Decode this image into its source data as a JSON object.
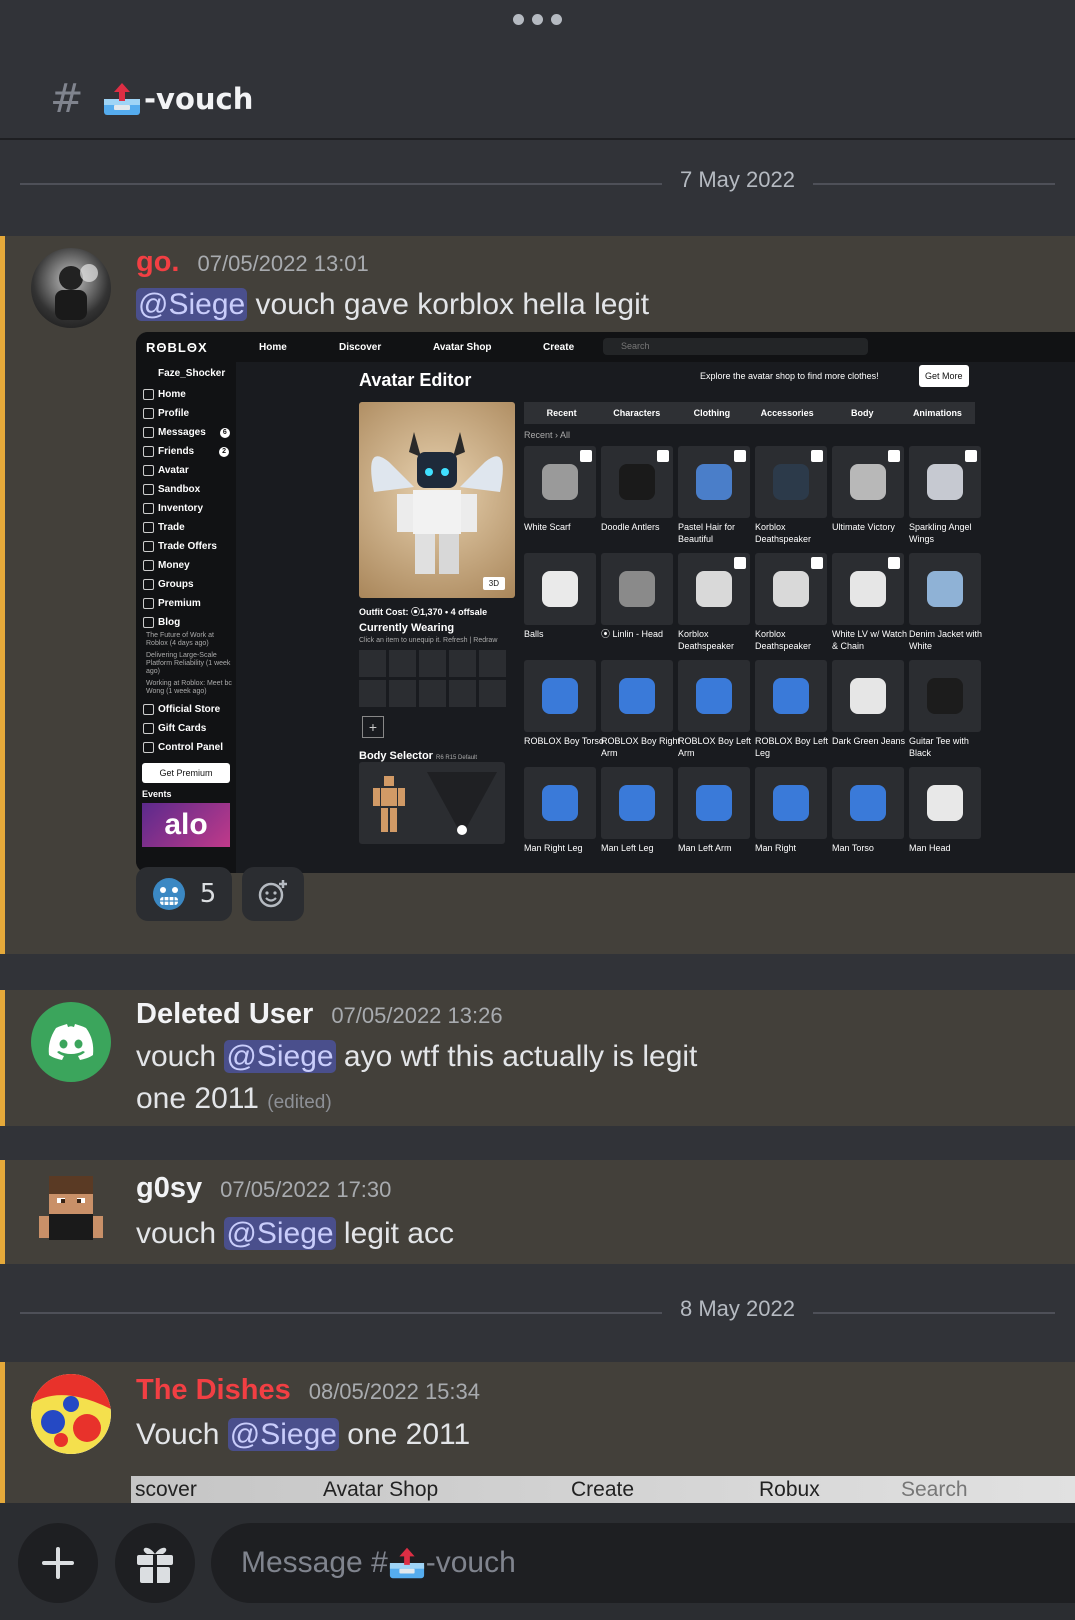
{
  "channel": {
    "hash": "#",
    "name": "-vouch",
    "emoji_icon": "inbox-tray-icon"
  },
  "dates": [
    "7 May 2022",
    "8 May 2022"
  ],
  "messages": [
    {
      "author": "go.",
      "author_color": "#f23f43",
      "timestamp": "07/05/2022 13:01",
      "mention": "@Siege",
      "text_after": " vouch gave korblox hella legit",
      "embed": {
        "top_nav": [
          "Home",
          "Discover",
          "Avatar Shop",
          "Create"
        ],
        "search_placeholder": "Search",
        "logo": "RΘBLΘX",
        "username": "Faze_Shocker",
        "sidebar": [
          "Home",
          "Profile",
          "Messages",
          "Friends",
          "Avatar",
          "Sandbox",
          "Inventory",
          "Trade",
          "Trade Offers",
          "Money",
          "Groups",
          "Premium",
          "Blog"
        ],
        "sidebar_badges": {
          "messages": "6",
          "friends": "2"
        },
        "blog_posts": [
          "The Future of Work at Roblox (4 days ago)",
          "Delivering Large-Scale Platform Reliability (1 week ago)",
          "Working at Roblox: Meet bc Wong (1 week ago)"
        ],
        "sidebar_bottom": [
          "Official Store",
          "Gift Cards",
          "Control Panel"
        ],
        "get_premium": "Get Premium",
        "events": "Events",
        "event_banner": "alo",
        "title": "Avatar Editor",
        "explore": "Explore the avatar shop to find more clothes!",
        "get_more": "Get More",
        "view_3d": "3D",
        "outfit_cost": "Outfit Cost: ⦿1,370 • 4 offsale",
        "currently_wearing": "Currently Wearing",
        "unequip_hint": "Click an item to unequip it.  Refresh | Redraw",
        "body_selector": "Body Selector",
        "body_tags": "R6  R15  Default",
        "tabs": [
          "Recent",
          "Characters",
          "Clothing",
          "Accessories",
          "Body",
          "Animations"
        ],
        "breadcrumb": "Recent › All",
        "items": [
          {
            "name": "White Scarf",
            "checked": true,
            "color": "#9a9a9a"
          },
          {
            "name": "Doodle Antlers",
            "checked": true,
            "color": "#1a1a1a"
          },
          {
            "name": "Pastel Hair for Beautiful",
            "checked": true,
            "color": "#4a7ec9"
          },
          {
            "name": "Korblox Deathspeaker",
            "checked": true,
            "color": "#2c3a4a"
          },
          {
            "name": "Ultimate Victory",
            "checked": true,
            "color": "#b8b8b8"
          },
          {
            "name": "Sparkling Angel Wings",
            "checked": true,
            "color": "#c6c9d1"
          },
          {
            "name": "Balls",
            "checked": false,
            "color": "#eaeaea"
          },
          {
            "name": "⦿ Linlin - Head",
            "checked": false,
            "color": "#8a8a8a"
          },
          {
            "name": "Korblox Deathspeaker",
            "checked": true,
            "color": "#d9d9d9"
          },
          {
            "name": "Korblox Deathspeaker",
            "checked": true,
            "color": "#d9d9d9"
          },
          {
            "name": "White LV w/ Watch & Chain",
            "checked": true,
            "color": "#e6e6e6"
          },
          {
            "name": "Denim Jacket with White",
            "checked": false,
            "color": "#8fb2d6"
          },
          {
            "name": "ROBLOX Boy Torso",
            "checked": false,
            "color": "#3a7ad9"
          },
          {
            "name": "ROBLOX Boy Right Arm",
            "checked": false,
            "color": "#3a7ad9"
          },
          {
            "name": "ROBLOX Boy Left Arm",
            "checked": false,
            "color": "#3a7ad9"
          },
          {
            "name": "ROBLOX Boy Left Leg",
            "checked": false,
            "color": "#3a7ad9"
          },
          {
            "name": "Dark Green Jeans",
            "checked": false,
            "color": "#e6e6e6"
          },
          {
            "name": "Guitar Tee with Black",
            "checked": false,
            "color": "#1c1c1c"
          },
          {
            "name": "Man Right Leg",
            "checked": false,
            "color": "#3a7ad9"
          },
          {
            "name": "Man Left Leg",
            "checked": false,
            "color": "#3a7ad9"
          },
          {
            "name": "Man Left Arm",
            "checked": false,
            "color": "#3a7ad9"
          },
          {
            "name": "Man Right",
            "checked": false,
            "color": "#3a7ad9"
          },
          {
            "name": "Man Torso",
            "checked": false,
            "color": "#3a7ad9"
          },
          {
            "name": "Man Head",
            "checked": false,
            "color": "#e8e8e8"
          }
        ]
      },
      "reaction": {
        "emoji_icon": "cold-face-icon",
        "count": "5"
      }
    },
    {
      "author": "Deleted User",
      "author_color": "#f2f3f5",
      "timestamp": "07/05/2022 13:26",
      "text_before": "vouch ",
      "mention": "@Siege",
      "text_after": " ayo wtf this actually is legit",
      "line2": "one 2011",
      "edited": "(edited)"
    },
    {
      "author": "g0sy",
      "author_color": "#f2f3f5",
      "timestamp": "07/05/2022 17:30",
      "text_before": "vouch ",
      "mention": "@Siege",
      "text_after": " legit acc"
    },
    {
      "author": "The Dishes",
      "author_color": "#f23f43",
      "timestamp": "08/05/2022 15:34",
      "text_before": "Vouch ",
      "mention": "@Siege",
      "text_after": " one 2011",
      "embed_peek": [
        "scover",
        "Avatar Shop",
        "Create",
        "Robux",
        "Search"
      ]
    }
  ],
  "composer": {
    "placeholder_prefix": "Message #",
    "placeholder_suffix": "-vouch"
  },
  "colors": {
    "background": "#313338",
    "highlight": "#43403a",
    "highlight_bar": "#e5a93a",
    "mention_bg": "#4a4f8c",
    "discord_green": "#3ba55c"
  }
}
